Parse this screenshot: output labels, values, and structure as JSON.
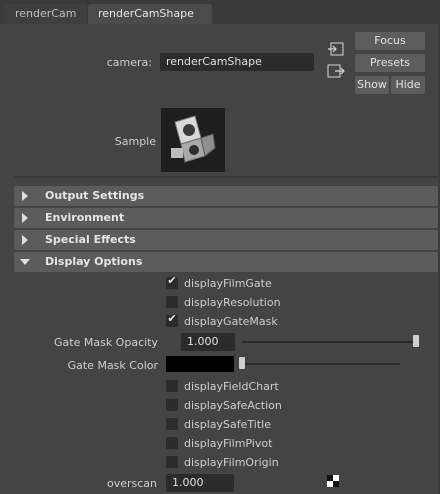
{
  "tabs": [
    {
      "label": "renderCam"
    },
    {
      "label": "renderCamShape"
    }
  ],
  "camera": {
    "label": "camera:",
    "value": "renderCamShape",
    "buttons": {
      "focus": "Focus",
      "presets": "Presets",
      "show": "Show",
      "hide": "Hide"
    }
  },
  "sample": {
    "label": "Sample"
  },
  "sections": [
    {
      "label": "Output Settings",
      "expanded": false
    },
    {
      "label": "Environment",
      "expanded": false
    },
    {
      "label": "Special Effects",
      "expanded": false
    },
    {
      "label": "Display Options",
      "expanded": true
    }
  ],
  "display_options": {
    "checkboxes_top": [
      {
        "label": "displayFilmGate",
        "checked": true
      },
      {
        "label": "displayResolution",
        "checked": false
      },
      {
        "label": "displayGateMask",
        "checked": true
      }
    ],
    "gate_mask_opacity": {
      "label": "Gate Mask Opacity",
      "value": "1.000",
      "slider_fraction": 1.0
    },
    "gate_mask_color": {
      "label": "Gate Mask Color",
      "color": "#000000",
      "slider_fraction": 0.0
    },
    "checkboxes_bottom": [
      {
        "label": "displayFieldChart",
        "checked": false
      },
      {
        "label": "displaySafeAction",
        "checked": false
      },
      {
        "label": "displaySafeTitle",
        "checked": false
      },
      {
        "label": "displayFilmPivot",
        "checked": false
      },
      {
        "label": "displayFilmOrigin",
        "checked": false
      }
    ],
    "overscan": {
      "label": "overscan",
      "value": "1.000"
    }
  },
  "colors": {
    "background": "#444444",
    "section": "#5c5c5c",
    "field": "#2b2b2b",
    "button": "#5d5d5d"
  }
}
